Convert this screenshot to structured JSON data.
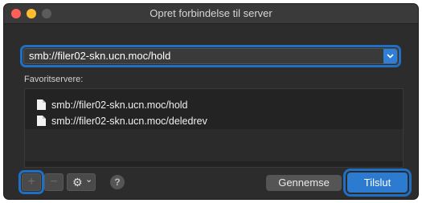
{
  "window": {
    "title": "Opret forbindelse til server"
  },
  "address": {
    "value": "smb://filer02-skn.ucn.moc/hold"
  },
  "favorites": {
    "label": "Favoritservere:",
    "items": [
      {
        "label": "smb://filer02-skn.ucn.moc/hold"
      },
      {
        "label": "smb://filer02-skn.ucn.moc/deledrev"
      }
    ]
  },
  "toolbar": {
    "plus": "+",
    "minus": "−",
    "gear": "⚙",
    "gear_caret": "⌄",
    "help": "?"
  },
  "buttons": {
    "browse": "Gennemse",
    "connect": "Tilslut"
  },
  "icons": {
    "close": "close-traffic-icon",
    "minimize": "minimize-traffic-icon",
    "zoom": "zoom-traffic-icon",
    "dropdown": "chevron-down-icon",
    "document": "document-icon",
    "gear": "gear-icon",
    "help": "help-icon"
  },
  "colors": {
    "accent": "#2d7ad1",
    "close": "#fe5f57",
    "minimize": "#febc2e",
    "background": "#2c2c2c"
  }
}
